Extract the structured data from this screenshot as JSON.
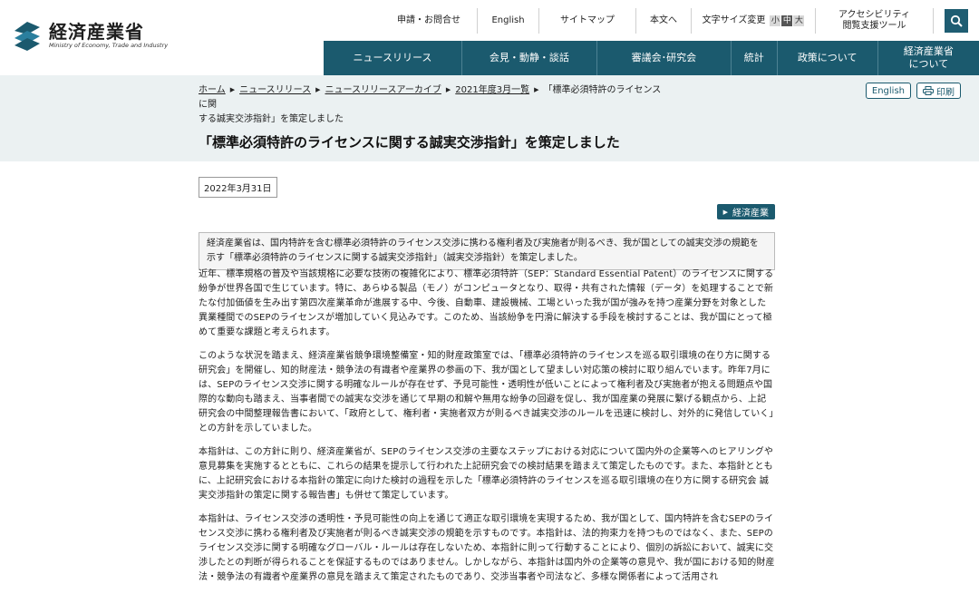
{
  "header": {
    "logo": {
      "jp": "経済産業省",
      "en": "Ministry of Economy, Trade and Industry"
    },
    "utility": {
      "contact": "申請・お問合せ",
      "english": "English",
      "sitemap": "サイトマップ",
      "skip": "本文へ",
      "font_size_label": "文字サイズ変更",
      "font_small": "小",
      "font_medium": "中",
      "font_large": "大",
      "accessibility_line1": "アクセシビリティ",
      "accessibility_line2": "閲覧支援ツール"
    },
    "nav": {
      "news": "ニュースリリース",
      "press": "会見・動静・談話",
      "councils": "審議会･研究会",
      "stats": "統計",
      "policy": "政策について",
      "about_line1": "経済産業省",
      "about_line2": "について"
    }
  },
  "breadcrumb": {
    "home": "ホーム",
    "news": "ニュースリリース",
    "archive": "ニュースリリースアーカイブ",
    "month": "2021年度3月一覧",
    "current_line1": "「標準必須特許のライセンスに関",
    "current_line2": "する誠実交渉指針」を策定しました"
  },
  "tools": {
    "english": "English",
    "print": "印刷"
  },
  "page_title": "「標準必須特許のライセンスに関する誠実交渉指針」を策定しました",
  "date": "2022年3月31日",
  "category": "経済産業",
  "summary": "経済産業省は、国内特許を含む標準必須特許のライセンス交渉に携わる権利者及び実施者が則るべき、我が国としての誠実交渉の規範を示す「標準必須特許のライセンスに関する誠実交渉指針」（誠実交渉指針）を策定しました。",
  "paragraphs": [
    "近年、標準規格の普及や当該規格に必要な技術の複雑化により、標準必須特許（SEP：Standard Essential Patent）のライセンスに関する紛争が世界各国で生じています。特に、あらゆる製品（モノ）がコンピュータとなり、取得・共有された情報（データ）を処理することで新たな付加価値を生み出す第四次産業革命が進展する中、今後、自動車、建設機械、工場といった我が国が強みを持つ産業分野を対象とした異業種間でのSEPのライセンスが増加していく見込みです。このため、当該紛争を円滑に解決する手段を検討することは、我が国にとって極めて重要な課題と考えられます。",
    "このような状況を踏まえ、経済産業省競争環境整備室・知的財産政策室では、「標準必須特許のライセンスを巡る取引環境の在り方に関する研究会」を開催し、知的財産法・競争法の有識者や産業界の参画の下、我が国として望ましい対応策の検討に取り組んでいます。昨年7月には、SEPのライセンス交渉に関する明確なルールが存在せず、予見可能性・透明性が低いことによって権利者及び実施者が抱える問題点や国際的な動向も踏まえ、当事者間での誠実な交渉を通じて早期の和解や無用な紛争の回避を促し、我が国産業の発展に繋げる観点から、上記研究会の中間整理報告書において、「政府として、権利者・実施者双方が則るべき誠実交渉のルールを迅速に検討し、対外的に発信していく」との方針を示していました。",
    "本指針は、この方針に則り、経済産業省が、SEPのライセンス交渉の主要なステップにおける対応について国内外の企業等へのヒアリングや意見募集を実施するとともに、これらの結果を提示して行われた上記研究会での検討結果を踏まえて策定したものです。また、本指針とともに、上記研究会における本指針の策定に向けた検討の過程を示した「標準必須特許のライセンスを巡る取引環境の在り方に関する研究会 誠実交渉指針の策定に関する報告書」も併せて策定しています。",
    "本指針は、ライセンス交渉の透明性・予見可能性の向上を通じて適正な取引環境を実現するため、我が国として、国内特許を含むSEPのライセンス交渉に携わる権利者及び実施者が則るべき誠実交渉の規範を示すものです。本指針は、法的拘束力を持つものではなく、また、SEPのライセンス交渉に関する明確なグローバル・ルールは存在しないため、本指針に則って行動することにより、個別の訴訟において、誠実に交渉したとの判断が得られることを保証するものではありません。しかしながら、本指針は国内外の企業等の意見や、我が国における知的財産法・競争法の有識者や産業界の意見を踏まえて策定されたものであり、交渉当事者や司法など、多様な関係者によって活用され"
  ]
}
